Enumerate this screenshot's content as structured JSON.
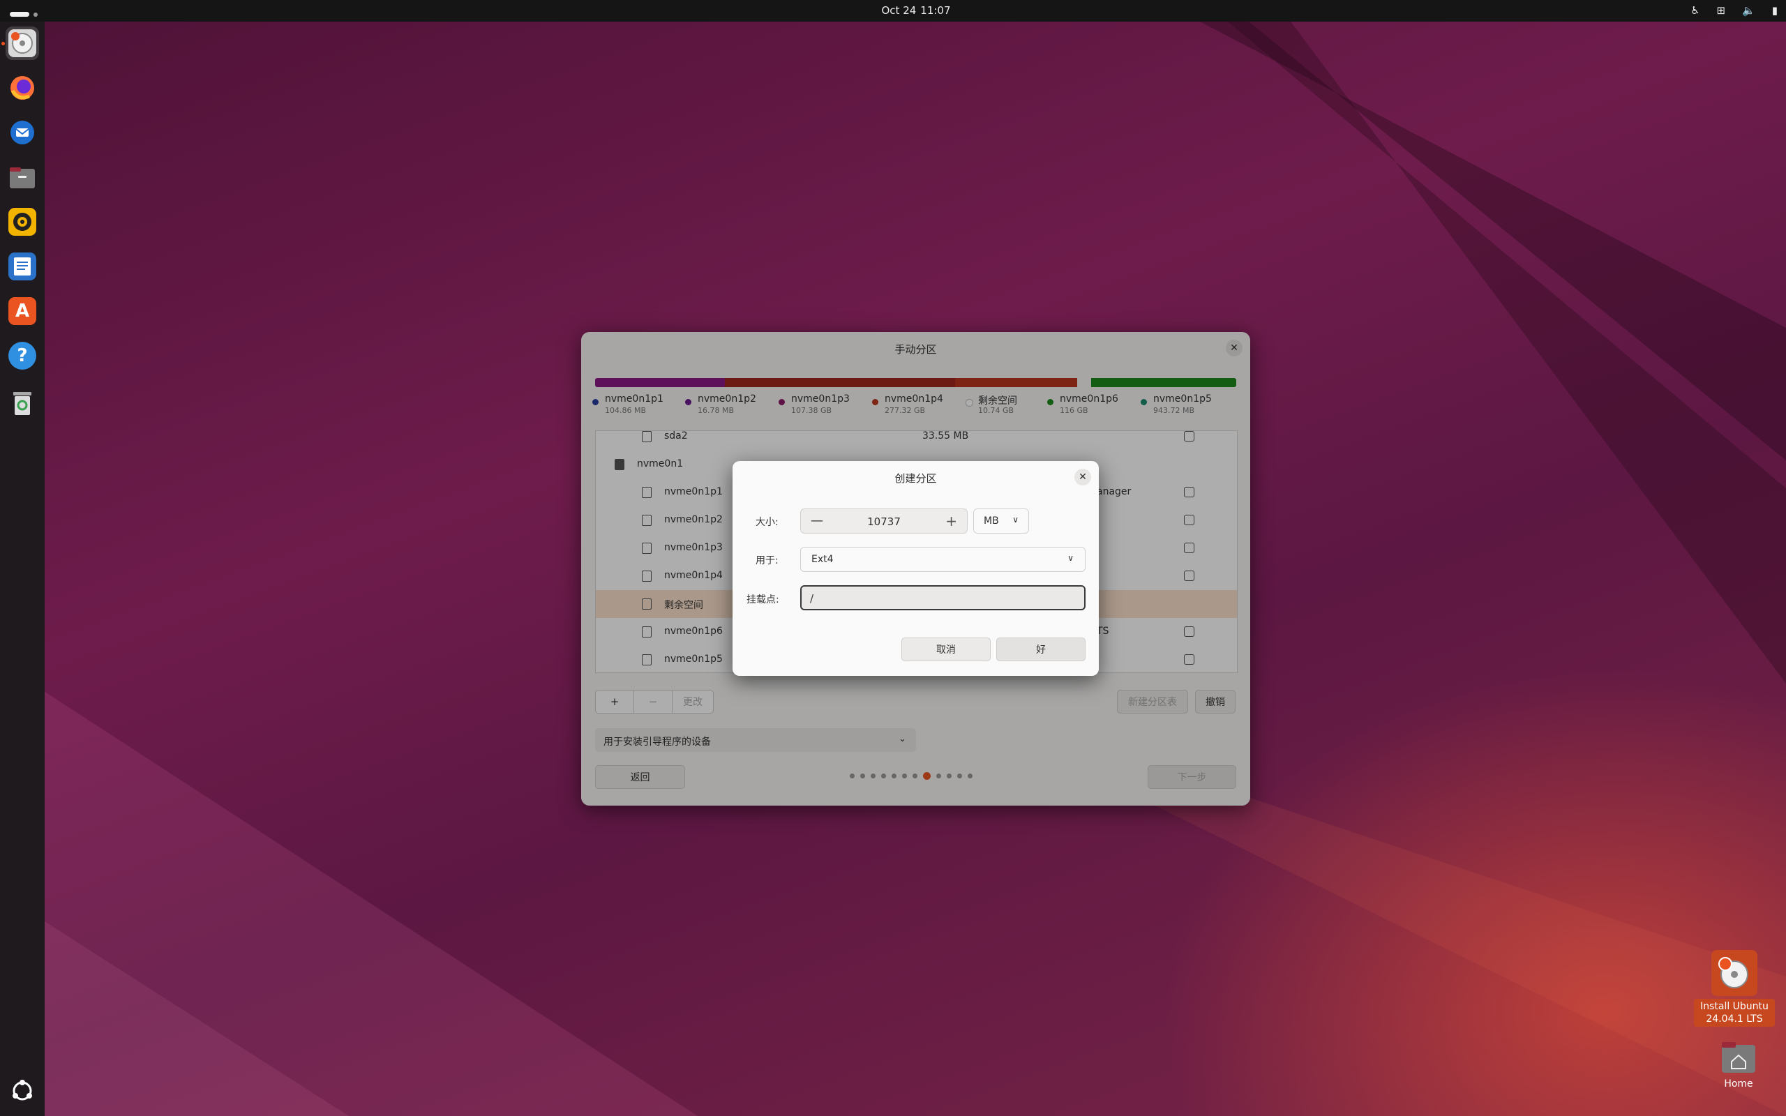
{
  "topbar": {
    "date": "Oct 24",
    "time": "11:07",
    "icons": [
      "accessibility-icon",
      "network-icon",
      "volume-icon",
      "battery-icon"
    ]
  },
  "dock": {
    "apps": [
      {
        "name": "ubuntu-installer",
        "icon": "installer-disk-icon",
        "active": true
      },
      {
        "name": "firefox",
        "icon": "firefox-icon"
      },
      {
        "name": "thunderbird",
        "icon": "thunderbird-icon"
      },
      {
        "name": "files",
        "icon": "folder-icon"
      },
      {
        "name": "rhythmbox",
        "icon": "speaker-icon"
      },
      {
        "name": "libreoffice-writer",
        "icon": "document-icon"
      },
      {
        "name": "app-center",
        "icon": "store-icon"
      },
      {
        "name": "help",
        "icon": "question-icon"
      },
      {
        "name": "trash",
        "icon": "trash-icon"
      }
    ],
    "show_apps_icon": "show-apps-icon"
  },
  "main_window": {
    "title": "手动分区",
    "usage_bar": [
      {
        "color": "#8b1a85",
        "fraction": 0.202
      },
      {
        "color": "#a3271e",
        "fraction": 0.36
      },
      {
        "color": "#b8361f",
        "fraction": 0.19
      },
      {
        "color": "#f6f5f4",
        "fraction": 0.022
      },
      {
        "color": "#1d8a1d",
        "fraction": 0.226
      }
    ],
    "legend": [
      {
        "name": "nvme0n1p1",
        "size": "104.86 MB",
        "color": "#2a3f9e"
      },
      {
        "name": "nvme0n1p2",
        "size": "16.78 MB",
        "color": "#6a1a8c"
      },
      {
        "name": "nvme0n1p3",
        "size": "107.38 GB",
        "color": "#8b1a66"
      },
      {
        "name": "nvme0n1p4",
        "size": "277.32 GB",
        "color": "#b8361f"
      },
      {
        "name": "剩余空间",
        "size": "10.74 GB",
        "color": "#ffffff"
      },
      {
        "name": "nvme0n1p6",
        "size": "116 GB",
        "color": "#1d8a1d"
      },
      {
        "name": "nvme0n1p5",
        "size": "943.72 MB",
        "color": "#1d8a6a"
      }
    ],
    "rows": [
      {
        "name": "sda2",
        "size": "33.55 MB",
        "extra": "",
        "level": 2,
        "checkbox": true
      },
      {
        "name": "nvme0n1",
        "size": "",
        "extra": "",
        "level": 1,
        "checkbox": false
      },
      {
        "name": "nvme0n1p1",
        "size": "",
        "extra": "anager",
        "level": 2,
        "checkbox": true
      },
      {
        "name": "nvme0n1p2",
        "size": "",
        "extra": "",
        "level": 2,
        "checkbox": true
      },
      {
        "name": "nvme0n1p3",
        "size": "",
        "extra": "",
        "level": 2,
        "checkbox": true
      },
      {
        "name": "nvme0n1p4",
        "size": "",
        "extra": "",
        "level": 2,
        "checkbox": true
      },
      {
        "name": "剩余空间",
        "size": "",
        "extra": "",
        "level": 2,
        "checkbox": false,
        "selected": true
      },
      {
        "name": "nvme0n1p6",
        "size": "",
        "extra": "TS",
        "level": 2,
        "checkbox": true
      },
      {
        "name": "nvme0n1p5",
        "size": "",
        "extra": "",
        "level": 2,
        "checkbox": true
      }
    ],
    "toolbar": {
      "add": "+",
      "remove": "−",
      "change": "更改"
    },
    "new_table_button": "新建分区表",
    "revert_button": "撤销",
    "bootloader_label": "用于安装引导程序的设备",
    "back_button": "返回",
    "next_button": "下一步",
    "progress": {
      "total_steps": 12,
      "current_step": 8
    }
  },
  "dialog": {
    "title": "创建分区",
    "size_label": "大小:",
    "size_value": "10737",
    "unit": "MB",
    "use_label": "用于:",
    "filesystem": "Ext4",
    "mount_label": "挂载点:",
    "mount_value": "/",
    "cancel_button": "取消",
    "ok_button": "好"
  },
  "desktop": {
    "install_label_line1": "Install Ubuntu",
    "install_label_line2": "24.04.1 LTS",
    "home_label": "Home"
  }
}
